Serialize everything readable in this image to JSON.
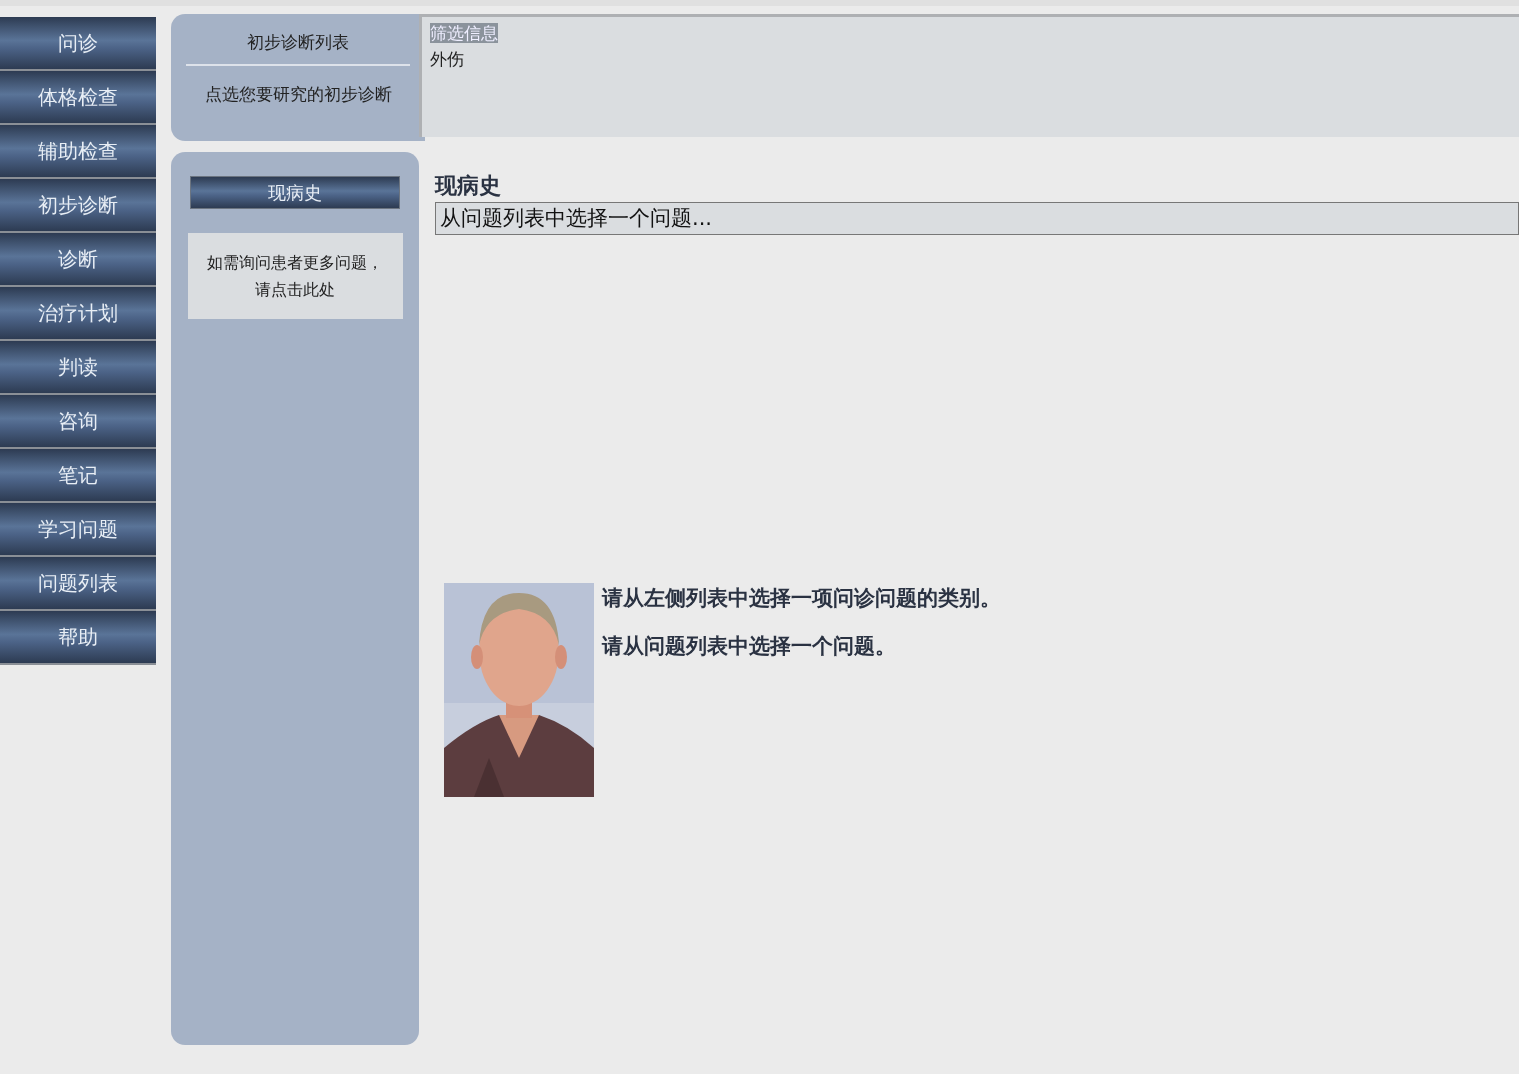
{
  "nav": {
    "items": [
      "问诊",
      "体格检查",
      "辅助检查",
      "初步诊断",
      "诊断",
      "治疗计划",
      "判读",
      "咨询",
      "笔记",
      "学习问题",
      "问题列表",
      "帮助"
    ]
  },
  "diagnosis_panel": {
    "title": "初步诊断列表",
    "hint": "点选您要研究的初步诊断"
  },
  "filter": {
    "title": "筛选信息",
    "items": [
      "外伤"
    ]
  },
  "category_panel": {
    "category_button": "现病史",
    "more_questions_link": "如需询问患者更多问题，请点击此处"
  },
  "content": {
    "heading": "现病史",
    "question_select": {
      "value": "从问题列表中选择一个问题..."
    },
    "instructions": [
      "请从左侧列表中选择一项问诊问题的类别。",
      "请从问题列表中选择一个问题。"
    ]
  }
}
